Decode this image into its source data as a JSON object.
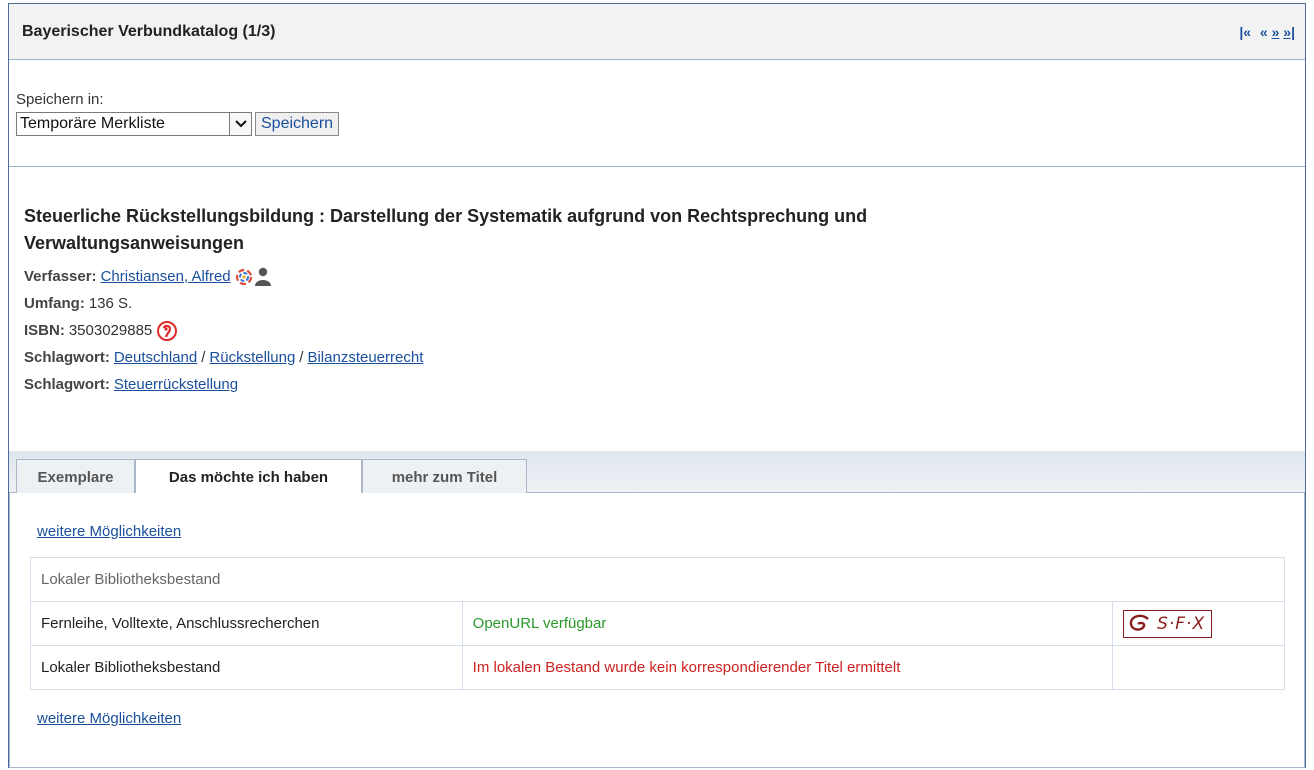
{
  "header": {
    "title": "Bayerischer Verbundkatalog (1/3)",
    "pager": {
      "first": "|«",
      "prev": "«",
      "next": "»",
      "last": "»|"
    }
  },
  "save": {
    "label": "Speichern in:",
    "selected_option": "Temporäre Merkliste",
    "button": "Speichern"
  },
  "record": {
    "title": "Steuerliche Rückstellungsbildung : Darstellung der Systematik aufgrund von Rechtsprechung und Verwaltungsanweisungen",
    "author_label": "Verfasser:",
    "author": "Christiansen, Alfred",
    "extent_label": "Umfang:",
    "extent": "136 S.",
    "isbn_label": "ISBN:",
    "isbn": "3503029885",
    "subject1_label": "Schlagwort:",
    "subject1": [
      "Deutschland",
      "Rückstellung",
      "Bilanzsteuerrecht"
    ],
    "subject2_label": "Schlagwort:",
    "subject2": "Steuerrückstellung"
  },
  "tabs": [
    "Exemplare",
    "Das möchte ich haben",
    "mehr zum Titel"
  ],
  "active_tab": "Das möchte ich haben",
  "holdings": {
    "more_link_top": "weitere Möglichkeiten",
    "more_link_bottom": "weitere Möglichkeiten",
    "header_row": "Lokaler Bibliotheksbestand",
    "rows": [
      {
        "label": "Fernleihe, Volltexte, Anschlussrecherchen",
        "status": "OpenURL verfügbar",
        "service": "S·F·X"
      },
      {
        "label": "Lokaler Bibliotheksbestand",
        "status": "Im lokalen Bestand wurde kein korrespondierender Titel ermittelt",
        "service": ""
      }
    ]
  },
  "colors": {
    "link": "#1a4f9c",
    "available": "#2a9a2a",
    "unavailable": "#cc2222",
    "sfx": "#8a1f1f"
  },
  "icons": {
    "author": "people-network-icon",
    "isbn": "isbn-link-icon",
    "sfx": "sfx-logo-icon"
  }
}
